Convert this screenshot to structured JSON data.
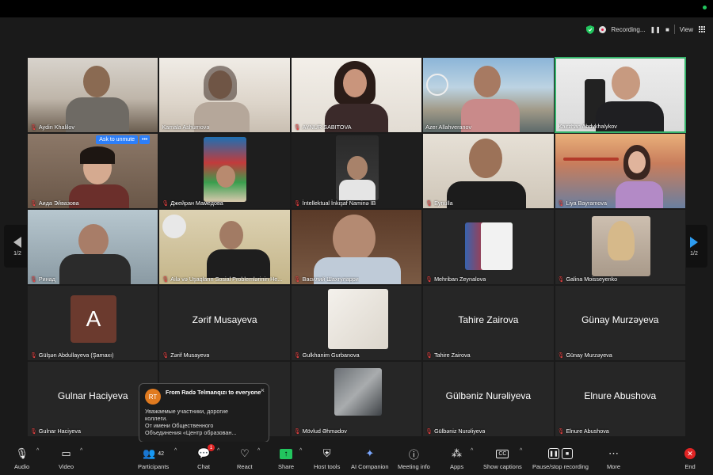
{
  "status": {
    "recording_label": "Recording...",
    "view_label": "View"
  },
  "nav": {
    "page_left": "1/2",
    "page_right": "1/2"
  },
  "tiles": [
    {
      "name": "Aydin Khalilov"
    },
    {
      "name": "Kamala Ashumova"
    },
    {
      "name": "AYNUR SABITOVA"
    },
    {
      "name": "Azer Allahveranov"
    },
    {
      "name": "Kairzhan Abdykhalykov"
    },
    {
      "name": "Аида Эйвазова"
    },
    {
      "name": "Джейран Мамедова"
    },
    {
      "name": "İntellektual İnkişaf Naminə İB"
    },
    {
      "name": "Eynulla"
    },
    {
      "name": "Liya Bayramova"
    },
    {
      "name": "Ринад"
    },
    {
      "name": "Ailə və Uşaqların Sosial Problemlərinin He..."
    },
    {
      "name": "Василий Шахгуларри"
    },
    {
      "name": "Mehriban Zeynalova"
    },
    {
      "name": "Galina Moisseyenko"
    },
    {
      "name": "Gülşən Abdullayeva (Şamaxı)",
      "avatar_letter": "A"
    },
    {
      "name": "Zərif Musayeva",
      "big": "Zərif Musayeva"
    },
    {
      "name": "Gulkhanim Gurbanova"
    },
    {
      "name": "Tahire Zairova",
      "big": "Tahire Zairova"
    },
    {
      "name": "Günay Murzəyeva",
      "big": "Günay Murzəyeva"
    },
    {
      "name": "Gulnar Haciyeva",
      "big": "Gulnar Haciyeva"
    },
    {
      "name": ""
    },
    {
      "name": "Mövlud Əhmədov"
    },
    {
      "name": "Gülbəniz Nurəliyeva",
      "big": "Gülbəniz Nurəliyeva"
    },
    {
      "name": "Elnure Abushova",
      "big": "Elnure Abushova"
    }
  ],
  "unmute": {
    "label": "Ask to unmute",
    "more": "•••"
  },
  "chat_popup": {
    "avatar": "RT",
    "from": "From Radə Telmanqızı to everyone",
    "close": "×",
    "lines": [
      "Уважаемые участники, дорогие",
      "коллеги.",
      "От имени Общественного",
      "Объединения «Центр образован..."
    ]
  },
  "toolbar": {
    "audio": "Audio",
    "video": "Video",
    "participants": "Participants",
    "participants_count": "42",
    "chat": "Chat",
    "chat_badge": "1",
    "react": "React",
    "share": "Share",
    "host_tools": "Host tools",
    "ai_companion": "AI Companion",
    "meeting_info": "Meeting info",
    "apps": "Apps",
    "captions": "Show captions",
    "captions_icon": "CC",
    "recording": "Pause/stop recording",
    "more": "More",
    "end": "End"
  },
  "colors": {
    "active_border": "#35b36b",
    "muted_red": "#ef4444",
    "accent_blue": "#2d7ff9",
    "share_green": "#22c55e"
  }
}
